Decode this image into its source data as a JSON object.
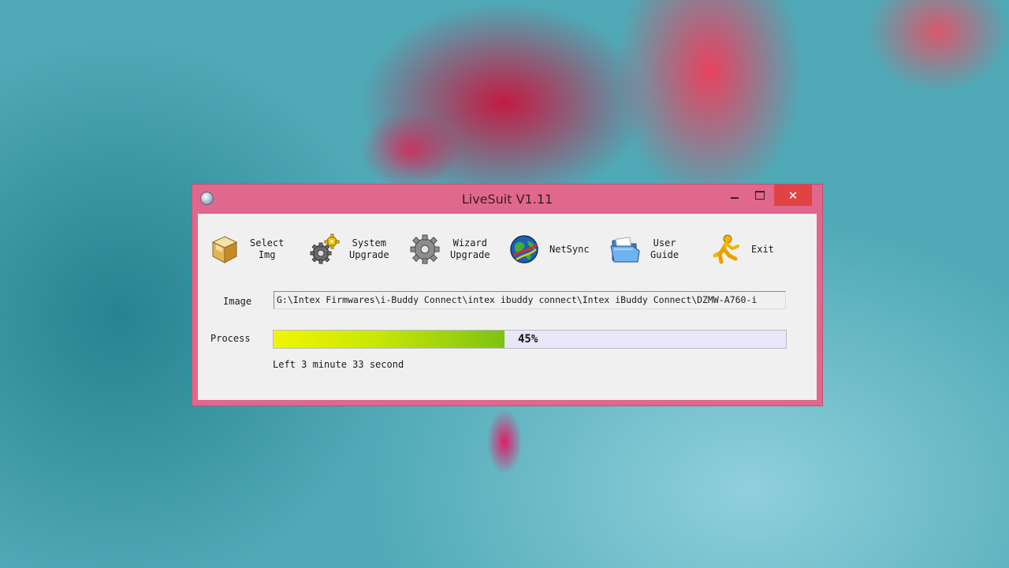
{
  "window": {
    "title": "LiveSuit V1.11",
    "close_glyph": "✕"
  },
  "toolbar": {
    "items": [
      {
        "line1": "Select",
        "line2": "Img",
        "icon": "select-img-cube-icon"
      },
      {
        "line1": "System",
        "line2": "Upgrade",
        "icon": "system-upgrade-gears-icon"
      },
      {
        "line1": "Wizard",
        "line2": "Upgrade",
        "icon": "wizard-upgrade-gear-icon"
      },
      {
        "line1": "NetSync",
        "line2": "",
        "icon": "netsync-globe-icon"
      },
      {
        "line1": "User",
        "line2": "Guide",
        "icon": "user-guide-folder-icon"
      },
      {
        "line1": "Exit",
        "line2": "",
        "icon": "exit-running-man-icon"
      }
    ]
  },
  "image": {
    "label": "Image",
    "path": "G:\\Intex Firmwares\\i-Buddy Connect\\intex ibuddy connect\\Intex iBuddy Connect\\DZMW-A760-i"
  },
  "process": {
    "label": "Process",
    "percent": 45,
    "percent_text": "45%",
    "remaining": "Left 3 minute 33 second"
  },
  "colors": {
    "window_frame": "#e0688d",
    "close_button": "#e04343",
    "client_background": "#f0f0f0",
    "progress_start": "#f2f500",
    "progress_end": "#7cc313",
    "progress_track": "#e8e6f7"
  }
}
